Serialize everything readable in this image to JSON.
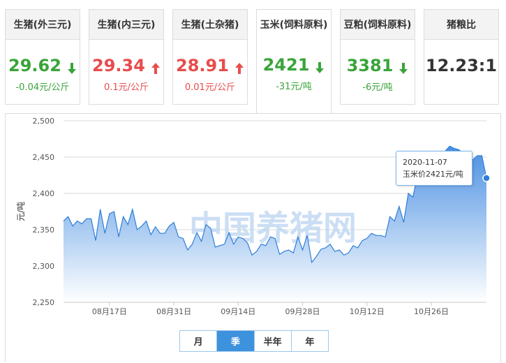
{
  "cards": [
    {
      "title": "生猪(外三元)",
      "price": "29.62",
      "change": "-0.04元/公斤",
      "trend": "down"
    },
    {
      "title": "生猪(内三元)",
      "price": "29.34",
      "change": "0.1元/公斤",
      "trend": "up"
    },
    {
      "title": "生猪(土杂猪)",
      "price": "28.91",
      "change": "0.01元/公斤",
      "trend": "up"
    },
    {
      "title": "玉米(饲料原料)",
      "price": "2421",
      "change": "-31元/吨",
      "trend": "down"
    },
    {
      "title": "豆粕(饲料原料)",
      "price": "3381",
      "change": "-6元/吨",
      "trend": "down"
    },
    {
      "title": "猪粮比",
      "price": "12.23:1",
      "change": "",
      "trend": "neutral"
    }
  ],
  "active_card_index": 3,
  "watermark": "中国养猪网",
  "tooltip": {
    "date": "2020-11-07",
    "text": "玉米价2421元/吨"
  },
  "range_buttons": [
    "月",
    "季",
    "半年",
    "年"
  ],
  "active_range_index": 1,
  "colors": {
    "down": "#3aa43a",
    "up": "#e84c4c",
    "line": "#2f7ed8",
    "area_top": "#4a90e2",
    "area_bottom": "#ffffff",
    "watermark": "#b9d3f0"
  },
  "chart_data": {
    "type": "area",
    "ylabel": "元/吨",
    "ylim": [
      2250,
      2500
    ],
    "yticks": [
      2250,
      2300,
      2350,
      2400,
      2450,
      2500
    ],
    "ytick_labels": [
      "2,250",
      "2,300",
      "2,350",
      "2,400",
      "2,450",
      "2,500"
    ],
    "xtick_labels": [
      "08月17日",
      "08月31日",
      "09月14日",
      "09月28日",
      "10月12日",
      "10月26日"
    ],
    "xtick_indices": [
      10,
      24,
      38,
      52,
      66,
      80
    ],
    "grid": true,
    "x": [
      "08-07",
      "08-08",
      "08-09",
      "08-10",
      "08-11",
      "08-12",
      "08-13",
      "08-14",
      "08-15",
      "08-16",
      "08-17",
      "08-18",
      "08-19",
      "08-20",
      "08-21",
      "08-22",
      "08-23",
      "08-24",
      "08-25",
      "08-26",
      "08-27",
      "08-28",
      "08-29",
      "08-30",
      "08-31",
      "09-01",
      "09-02",
      "09-03",
      "09-04",
      "09-05",
      "09-06",
      "09-07",
      "09-08",
      "09-09",
      "09-10",
      "09-11",
      "09-12",
      "09-13",
      "09-14",
      "09-15",
      "09-16",
      "09-17",
      "09-18",
      "09-19",
      "09-20",
      "09-21",
      "09-22",
      "09-23",
      "09-24",
      "09-25",
      "09-26",
      "09-27",
      "09-28",
      "09-29",
      "09-30",
      "10-01",
      "10-02",
      "10-03",
      "10-04",
      "10-05",
      "10-06",
      "10-07",
      "10-08",
      "10-09",
      "10-10",
      "10-11",
      "10-12",
      "10-13",
      "10-14",
      "10-15",
      "10-16",
      "10-17",
      "10-18",
      "10-19",
      "10-20",
      "10-21",
      "10-22",
      "10-23",
      "10-24",
      "10-25",
      "10-26",
      "10-27",
      "10-28",
      "10-29",
      "10-30",
      "10-31",
      "11-01",
      "11-02",
      "11-03",
      "11-04",
      "11-05",
      "11-06",
      "11-07"
    ],
    "series": [
      {
        "values": [
          2362,
          2368,
          2355,
          2362,
          2358,
          2365,
          2365,
          2335,
          2378,
          2345,
          2372,
          2375,
          2340,
          2368,
          2357,
          2378,
          2350,
          2355,
          2362,
          2343,
          2354,
          2345,
          2345,
          2355,
          2360,
          2340,
          2338,
          2322,
          2330,
          2346,
          2334,
          2357,
          2352,
          2326,
          2328,
          2330,
          2346,
          2330,
          2340,
          2338,
          2332,
          2315,
          2320,
          2330,
          2328,
          2340,
          2338,
          2316,
          2320,
          2322,
          2318,
          2340,
          2322,
          2342,
          2305,
          2313,
          2323,
          2325,
          2330,
          2320,
          2322,
          2315,
          2318,
          2328,
          2325,
          2335,
          2338,
          2345,
          2342,
          2342,
          2340,
          2368,
          2362,
          2382,
          2360,
          2400,
          2395,
          2425,
          2442,
          2450,
          2452,
          2445,
          2440,
          2458,
          2465,
          2462,
          2460,
          2455,
          2450,
          2446,
          2452,
          2452,
          2421
        ]
      }
    ]
  }
}
